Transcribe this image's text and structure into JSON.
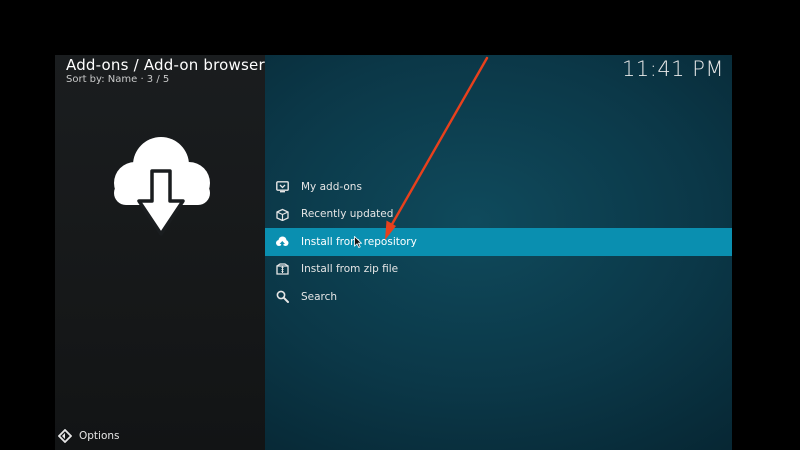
{
  "header": {
    "title": "Add-ons / Add-on browser",
    "subtitle": "Sort by: Name  ·  3 / 5",
    "clock": "11:41 PM"
  },
  "hero": {
    "icon": "cloud-download-icon"
  },
  "menu": {
    "focused_index": 2,
    "items": [
      {
        "label": "My add-ons",
        "icon": "monitor-box-icon"
      },
      {
        "label": "Recently updated",
        "icon": "open-box-icon"
      },
      {
        "label": "Install from repository",
        "icon": "cloud-upload-icon"
      },
      {
        "label": "Install from zip file",
        "icon": "zip-box-icon"
      },
      {
        "label": "Search",
        "icon": "search-icon"
      }
    ]
  },
  "footer": {
    "options_label": "Options",
    "options_icon": "diamond-arrows-icon"
  },
  "annotation": {
    "color": "#e8401c"
  },
  "colors": {
    "focus": "#0a8fb0",
    "left_panel": "#161819",
    "background": "#0b3747"
  }
}
